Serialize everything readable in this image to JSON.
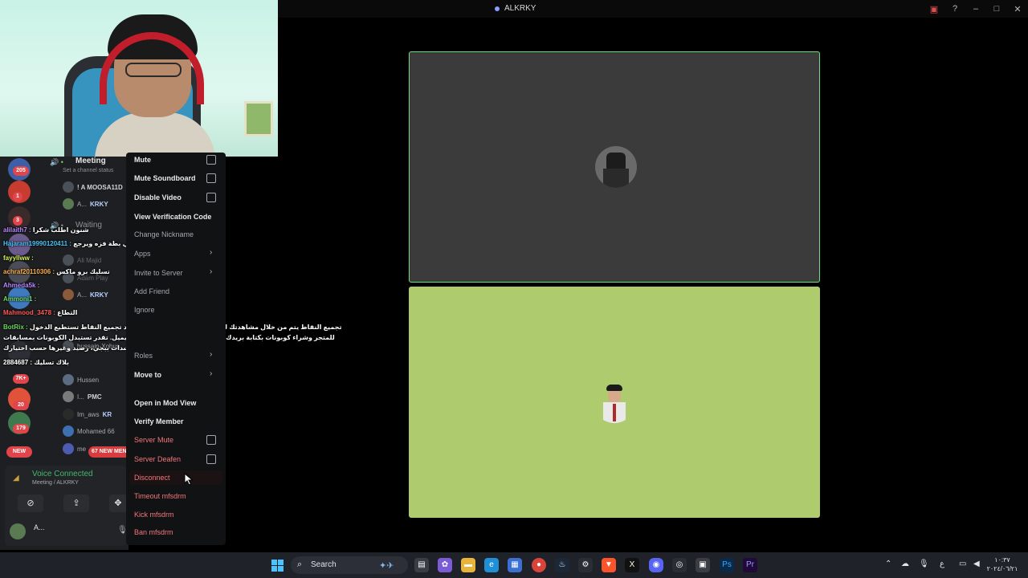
{
  "titlebar": {
    "app_title": "ALKRKY",
    "icons": [
      "inbox-icon",
      "help-icon",
      "minimize-icon",
      "maximize-icon",
      "close-icon"
    ]
  },
  "servers": [
    {
      "badge": "205"
    },
    {
      "badge": "1"
    },
    {
      "badge": "3"
    },
    {
      "badge": ""
    },
    {
      "badge": ""
    },
    {
      "badge": "7K+"
    },
    {
      "badge": "20"
    },
    {
      "badge": "179"
    }
  ],
  "channels": {
    "meeting": {
      "name": "Meeting",
      "status": "Set a channel status"
    },
    "meeting_members": [
      {
        "name": "! A MOOSA11D",
        "tag": ""
      },
      {
        "name": "A...",
        "tag": "KRKY"
      }
    ],
    "waiting": {
      "name": "Waiting"
    },
    "waiting_members": [
      {
        "name": "Ali Majid",
        "tag": ""
      },
      {
        "name": "Adam Play",
        "tag": ""
      },
      {
        "name": "A...",
        "tag": "KRKY"
      },
      {
        "name": "HASHI",
        "tag": ""
      },
      {
        "name": "hussain-Xohus",
        "tag": ""
      },
      {
        "name": "Hussen",
        "tag": ""
      },
      {
        "name": "I...",
        "tag": "PMC"
      },
      {
        "name": "Im_aws",
        "tag": "KR"
      },
      {
        "name": "Mohamed 66",
        "tag": ""
      },
      {
        "name": "me",
        "tag": ""
      }
    ],
    "new_badge": "NEW",
    "new_mentions": "67 NEW MENTIONS"
  },
  "chat": [
    {
      "user": "alilaith7 :",
      "msg": "شنون اطلب شكرا",
      "color": "p"
    },
    {
      "user": "Hajaram19990120411 :",
      "msg": "خلي بطة فزه ويرجع",
      "color": "c"
    },
    {
      "user": "fayyllww :",
      "msg": "",
      "color": "n"
    },
    {
      "user": "achraf20110306 :",
      "msg": "تسليك برو ماكس",
      "color": "o"
    },
    {
      "user": "Ahmeda5k :",
      "msg": "",
      "color": "p"
    },
    {
      "user": "Ammoni1 :",
      "msg": "",
      "color": "n"
    },
    {
      "user": "Mahmood_3478 :",
      "msg": "التطاع",
      "color": "r"
    },
    {
      "user": "BotRix :",
      "msg": "تجميع النقاط يتم من خلال مشاهدتك للبث وتحليلاتك الإيجابية فقط. بعد تجميع النقاط تستطيع الدخول",
      "color": "n"
    },
    {
      "user": "",
      "msg": "للمتجر وشراء كوبونات بكتابة بريدك الإلكتروني للتواصل معك عبر الإيميل. تقدر تستبدل الكوبونات بمسابقات",
      "color": "n"
    },
    {
      "user": "",
      "msg": "مايكرافت، شدات ببجي، رصيد وغيرها حسب اختيارك",
      "color": "n"
    },
    {
      "user": "2884687 :",
      "msg": "بلاك تسليك",
      "color": "n"
    }
  ],
  "voice_panel": {
    "title": "Voice Connected",
    "subtitle": "Meeting / ALKRKY",
    "user_name": "A...",
    "buttons": [
      "camera-off-icon",
      "screen-share-icon",
      "activities-icon"
    ]
  },
  "context_menu": {
    "mute": "Mute",
    "mute_soundboard": "Mute Soundboard",
    "disable_video": "Disable Video",
    "view_verification_code": "View Verification Code",
    "change_nickname": "Change Nickname",
    "apps": "Apps",
    "invite_to_server": "Invite to Server",
    "add_friend": "Add Friend",
    "ignore": "Ignore",
    "roles": "Roles",
    "move_to": "Move to",
    "open_in_mod_view": "Open in Mod View",
    "verify_member": "Verify Member",
    "server_mute": "Server Mute",
    "server_deafen": "Server Deafen",
    "disconnect": "Disconnect",
    "timeout": "Timeout mfsdrm",
    "kick": "Kick mfsdrm",
    "ban": "Ban mfsdrm"
  },
  "taskbar": {
    "search_label": "Search",
    "clock_time": "١٠:٣٧",
    "clock_date": "٢٠٢٤/٠٦/٢١",
    "lang": "ع"
  }
}
